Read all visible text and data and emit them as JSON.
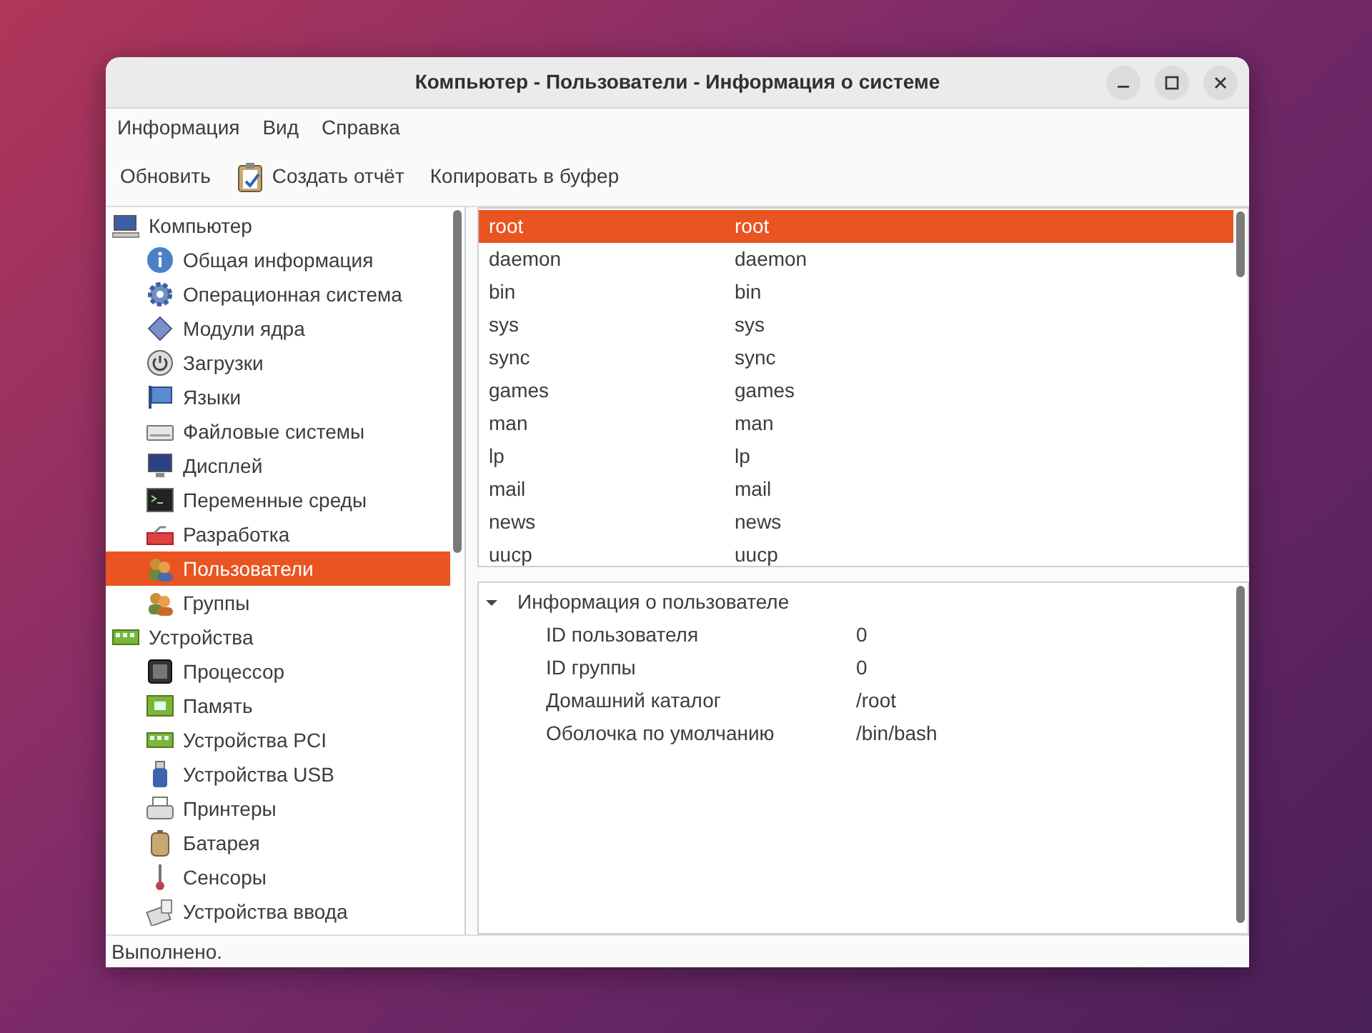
{
  "window": {
    "title": "Компьютер - Пользователи - Информация о системе"
  },
  "menu": [
    "Информация",
    "Вид",
    "Справка"
  ],
  "toolbar": [
    {
      "label": "Обновить",
      "kind": "plain"
    },
    {
      "label": "Создать отчёт",
      "kind": "report"
    },
    {
      "label": "Копировать в буфер",
      "kind": "plain"
    }
  ],
  "sidebar": {
    "items": [
      {
        "label": "Компьютер",
        "selected": false,
        "children": [
          {
            "label": "Общая информация",
            "selected": false
          },
          {
            "label": "Операционная система",
            "selected": false
          },
          {
            "label": "Модули ядра",
            "selected": false
          },
          {
            "label": "Загрузки",
            "selected": false
          },
          {
            "label": "Языки",
            "selected": false
          },
          {
            "label": "Файловые системы",
            "selected": false
          },
          {
            "label": "Дисплей",
            "selected": false
          },
          {
            "label": "Переменные среды",
            "selected": false
          },
          {
            "label": "Разработка",
            "selected": false
          },
          {
            "label": "Пользователи",
            "selected": true
          },
          {
            "label": "Группы",
            "selected": false
          }
        ]
      },
      {
        "label": "Устройства",
        "selected": false,
        "children": [
          {
            "label": "Процессор",
            "selected": false
          },
          {
            "label": "Память",
            "selected": false
          },
          {
            "label": "Устройства PCI",
            "selected": false
          },
          {
            "label": "Устройства USB",
            "selected": false
          },
          {
            "label": "Принтеры",
            "selected": false
          },
          {
            "label": "Батарея",
            "selected": false
          },
          {
            "label": "Сенсоры",
            "selected": false
          },
          {
            "label": "Устройства ввода",
            "selected": false
          }
        ]
      }
    ]
  },
  "users": {
    "rows": [
      {
        "column_1": "root",
        "column_2": "root",
        "selected": true
      },
      {
        "column_1": "daemon",
        "column_2": "daemon",
        "selected": false
      },
      {
        "column_1": "bin",
        "column_2": "bin",
        "selected": false
      },
      {
        "column_1": "sys",
        "column_2": "sys",
        "selected": false
      },
      {
        "column_1": "sync",
        "column_2": "sync",
        "selected": false
      },
      {
        "column_1": "games",
        "column_2": "games",
        "selected": false
      },
      {
        "column_1": "man",
        "column_2": "man",
        "selected": false
      },
      {
        "column_1": "lp",
        "column_2": "lp",
        "selected": false
      },
      {
        "column_1": "mail",
        "column_2": "mail",
        "selected": false
      },
      {
        "column_1": "news",
        "column_2": "news",
        "selected": false
      },
      {
        "column_1": "uucp",
        "column_2": "uucp",
        "selected": false
      }
    ]
  },
  "details": {
    "title": "Информация о пользователе",
    "expanded": true,
    "rows": [
      {
        "label": "ID пользователя",
        "value": "0"
      },
      {
        "label": "ID группы",
        "value": "0"
      },
      {
        "label": "Домашний каталог",
        "value": "/root"
      },
      {
        "label": "Оболочка по умолчанию",
        "value": "/bin/bash"
      }
    ]
  },
  "status_bar": "Выполнено."
}
